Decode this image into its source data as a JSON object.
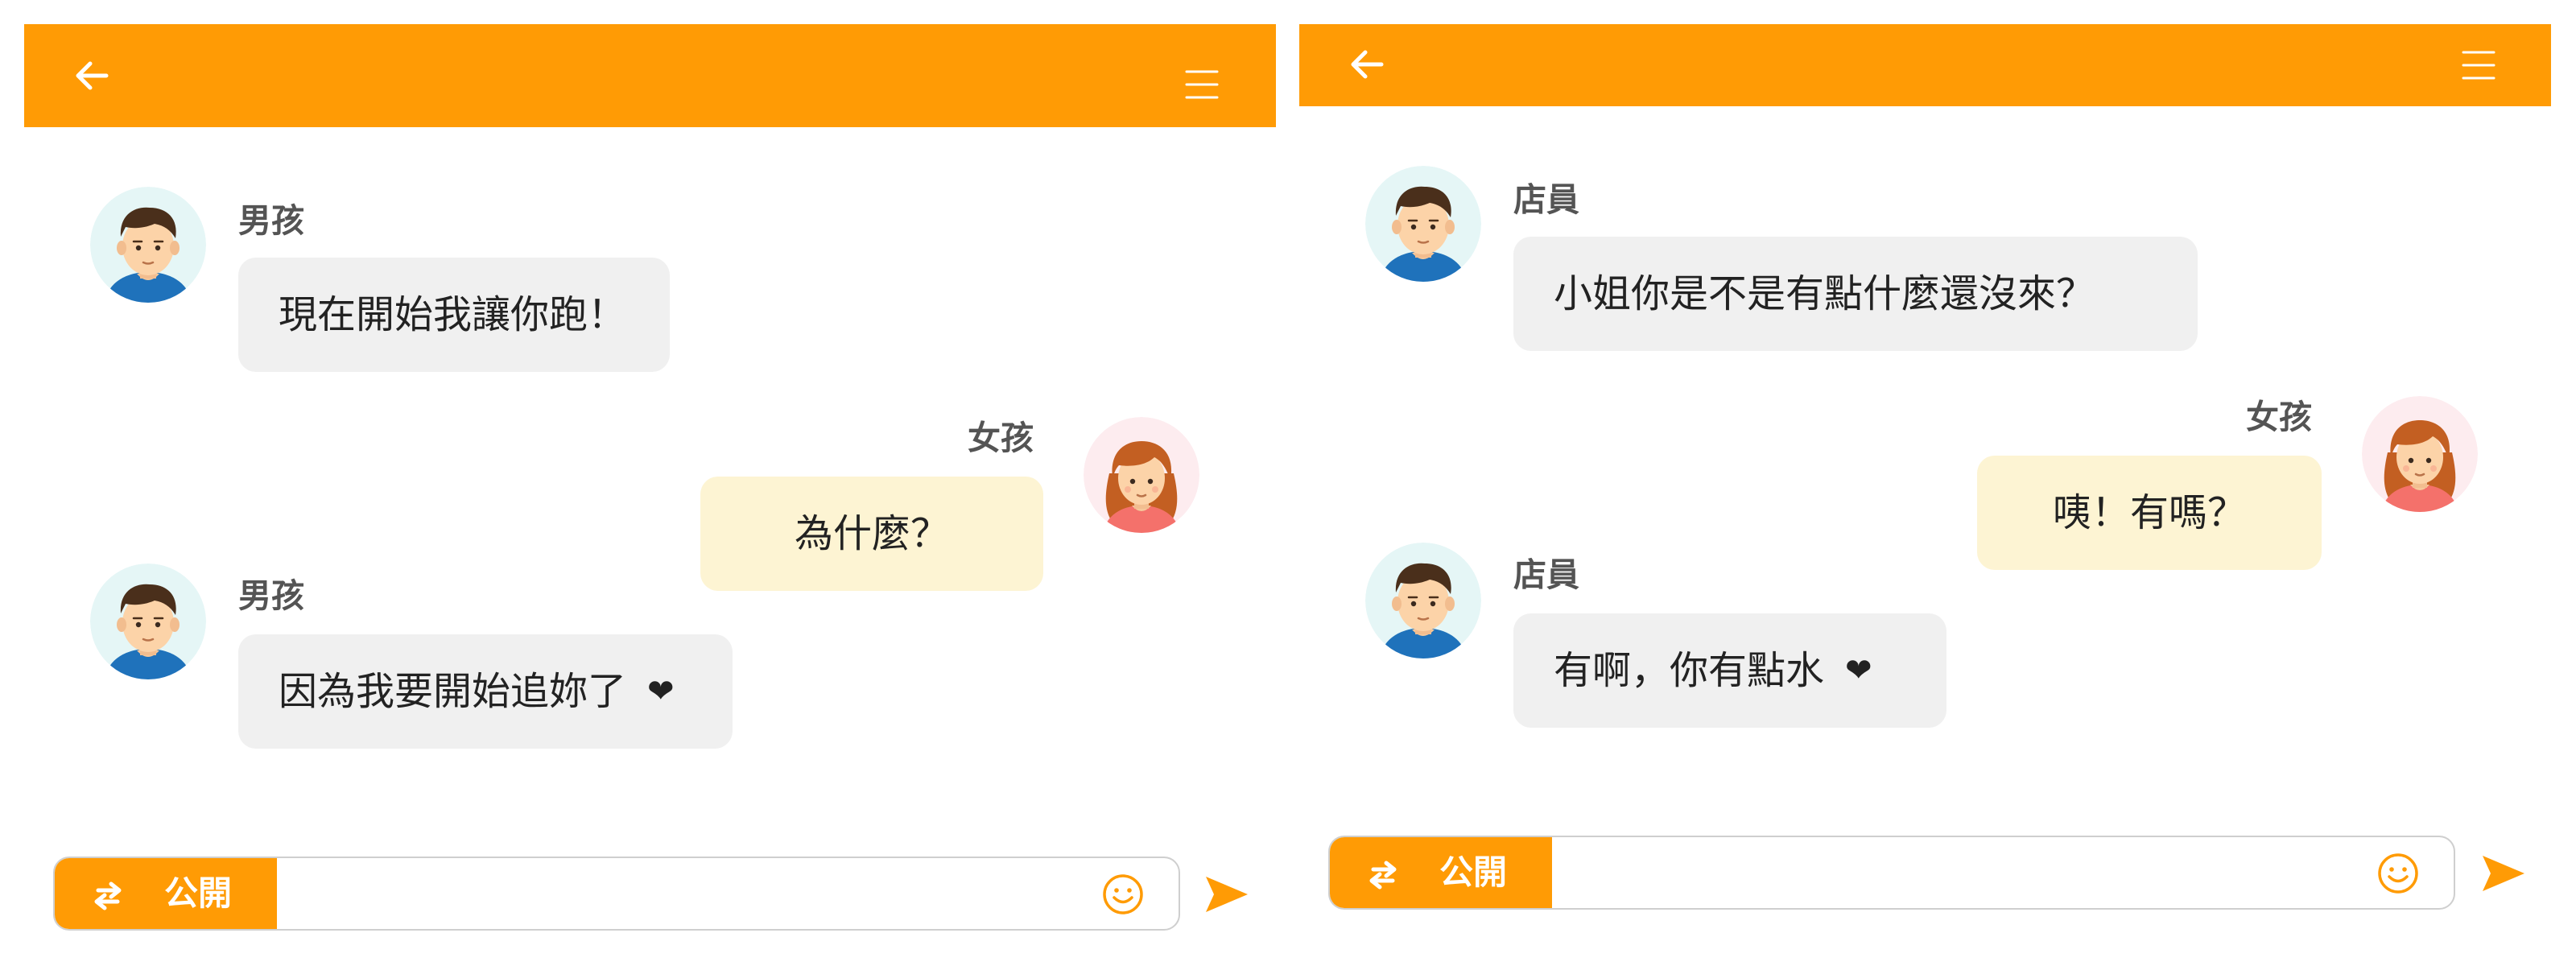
{
  "theme": {
    "accent": "#ff9b05",
    "incoming_bubble": "#f0f0f0",
    "outgoing_bubble": "#fdf4d3"
  },
  "icons": {
    "back": "arrow-left-icon",
    "menu": "hamburger-menu-icon",
    "swap": "swap-arrows-icon",
    "emoji": "smiley-icon",
    "send": "send-arrow-icon",
    "heart": "heart-icon"
  },
  "left": {
    "messages": [
      {
        "sender": "男孩",
        "text": "現在開始我讓你跑！",
        "side": "incoming",
        "avatar": "boy"
      },
      {
        "sender": "女孩",
        "text": "為什麼？",
        "side": "outgoing",
        "avatar": "girl"
      },
      {
        "sender": "男孩",
        "text": "因為我要開始追妳了",
        "emoji": "❤",
        "side": "incoming",
        "avatar": "boy"
      }
    ],
    "composer": {
      "visibility_label": "公開",
      "value": ""
    }
  },
  "right": {
    "messages": [
      {
        "sender": "店員",
        "text": "小姐你是不是有點什麼還沒來？",
        "side": "incoming",
        "avatar": "boy"
      },
      {
        "sender": "女孩",
        "text": "咦！有嗎？",
        "side": "outgoing",
        "avatar": "girl"
      },
      {
        "sender": "店員",
        "text": "有啊，你有點水",
        "emoji": "❤",
        "side": "incoming",
        "avatar": "boy"
      }
    ],
    "composer": {
      "visibility_label": "公開",
      "value": ""
    }
  }
}
